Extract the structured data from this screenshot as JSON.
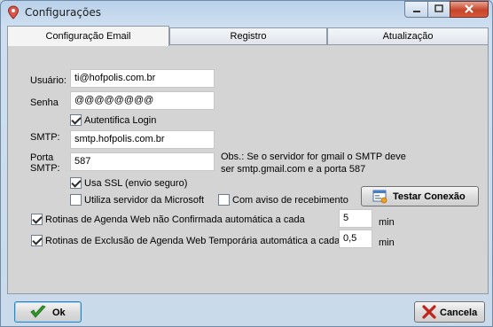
{
  "window": {
    "title": "Configurações"
  },
  "tabs": [
    {
      "label": "Configuração Email"
    },
    {
      "label": "Registro"
    },
    {
      "label": "Atualização"
    }
  ],
  "form": {
    "usuario_label": "Usuário:",
    "usuario_value": "ti@hofpolis.com.br",
    "senha_label": "Senha",
    "senha_value": "@@@@@@@@",
    "autentifica_label": "Autentifica Login",
    "autentifica_checked": true,
    "smtp_label": "SMTP:",
    "smtp_value": "smtp.hofpolis.com.br",
    "porta_label_1": "Porta",
    "porta_label_2": "SMTP:",
    "porta_value": "587",
    "obs_line1": "Obs.: Se o servidor for gmail o SMTP deve",
    "obs_line2": "ser smtp.gmail.com e a porta 587",
    "ssl_label": "Usa SSL (envio seguro)",
    "ssl_checked": true,
    "microsoft_label": "Utiliza servidor da Microsoft",
    "microsoft_checked": false,
    "aviso_label": "Com aviso de recebimento",
    "aviso_checked": false,
    "testar_label": "Testar Conexão",
    "rotina1_label": "Rotinas de Agenda Web não Confirmada automática a cada",
    "rotina1_checked": true,
    "rotina1_value": "5",
    "rotina1_unit": "min",
    "rotina2_label": "Rotinas de Exclusão de Agenda Web Temporária automática a cada",
    "rotina2_checked": true,
    "rotina2_value": "0,5",
    "rotina2_unit": "min"
  },
  "buttons": {
    "ok": "Ok",
    "cancel": "Cancela"
  }
}
